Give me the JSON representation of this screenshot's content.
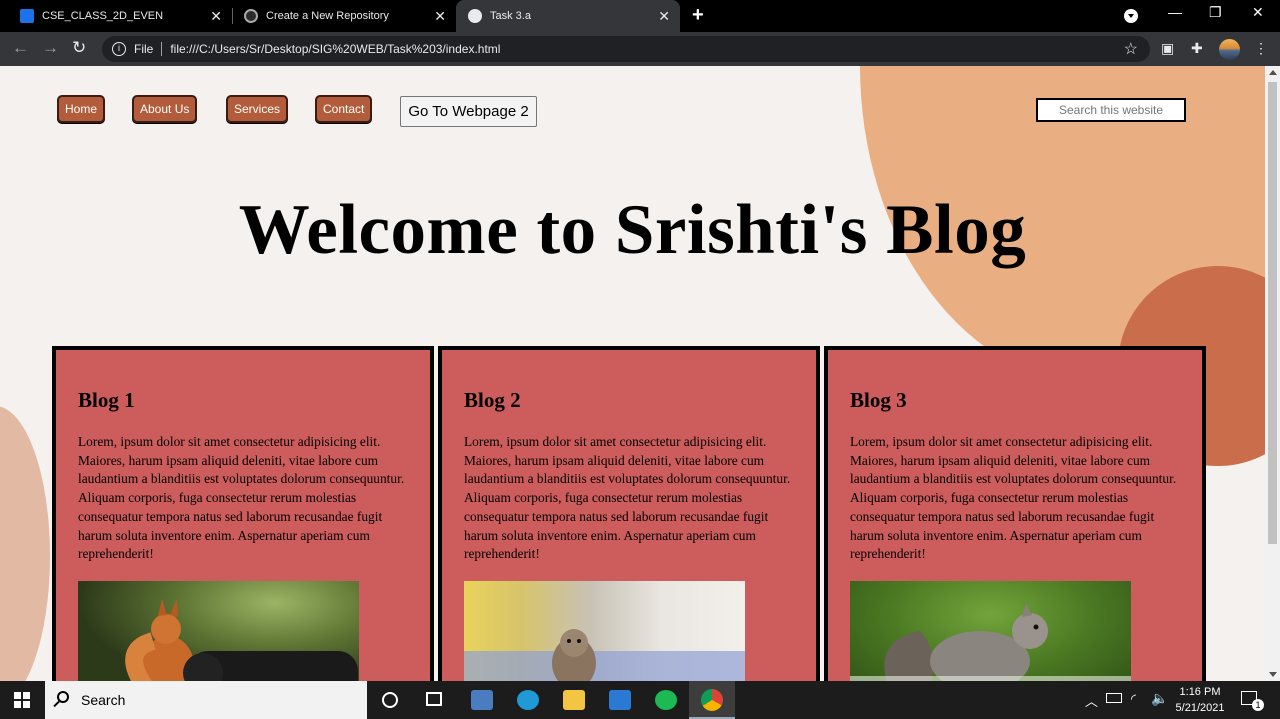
{
  "browser": {
    "tabs": [
      {
        "label": "CSE_CLASS_2D_EVEN",
        "icon": "classroom-icon"
      },
      {
        "label": "Create a New Repository",
        "icon": "github-icon"
      },
      {
        "label": "Task 3.a",
        "icon": "globe-icon",
        "active": true
      }
    ],
    "address": {
      "scheme_label": "File",
      "url": "file:///C:/Users/Sr/Desktop/SIG%20WEB/Task%203/index.html"
    }
  },
  "page": {
    "nav": {
      "home": "Home",
      "about": "About Us",
      "services": "Services",
      "contact": "Contact",
      "goto": "Go To Webpage 2"
    },
    "search": {
      "placeholder": "Search this website"
    },
    "hero_title": "Welcome to Srishti's Blog",
    "blogs": [
      {
        "title": "Blog 1",
        "body": "Lorem, ipsum dolor sit amet consectetur adipisicing elit. Maiores, harum ipsam aliquid deleniti, vitae labore cum laudantium a blanditiis est voluptates dolorum consequuntur. Aliquam corporis, fuga consectetur rerum molestias consequatur tempora natus sed laborum recusandae fugit harum soluta inventore enim. Aspernatur aperiam cum reprehenderit!"
      },
      {
        "title": "Blog 2",
        "body": "Lorem, ipsum dolor sit amet consectetur adipisicing elit. Maiores, harum ipsam aliquid deleniti, vitae labore cum laudantium a blanditiis est voluptates dolorum consequuntur. Aliquam corporis, fuga consectetur rerum molestias consequatur tempora natus sed laborum recusandae fugit harum soluta inventore enim. Aspernatur aperiam cum reprehenderit!"
      },
      {
        "title": "Blog 3",
        "body": "Lorem, ipsum dolor sit amet consectetur adipisicing elit. Maiores, harum ipsam aliquid deleniti, vitae labore cum laudantium a blanditiis est voluptates dolorum consequuntur. Aliquam corporis, fuga consectetur rerum molestias consequatur tempora natus sed laborum recusandae fugit harum soluta inventore enim. Aspernatur aperiam cum reprehenderit!"
      }
    ],
    "colors": {
      "card": "#cd5c5c",
      "nav_button": "#b35c3c",
      "background": "#f5f1ee",
      "blob": "#e9ae82"
    }
  },
  "taskbar": {
    "search_label": "Search",
    "time": "1:16 PM",
    "date": "5/21/2021",
    "notification_count": "1"
  }
}
